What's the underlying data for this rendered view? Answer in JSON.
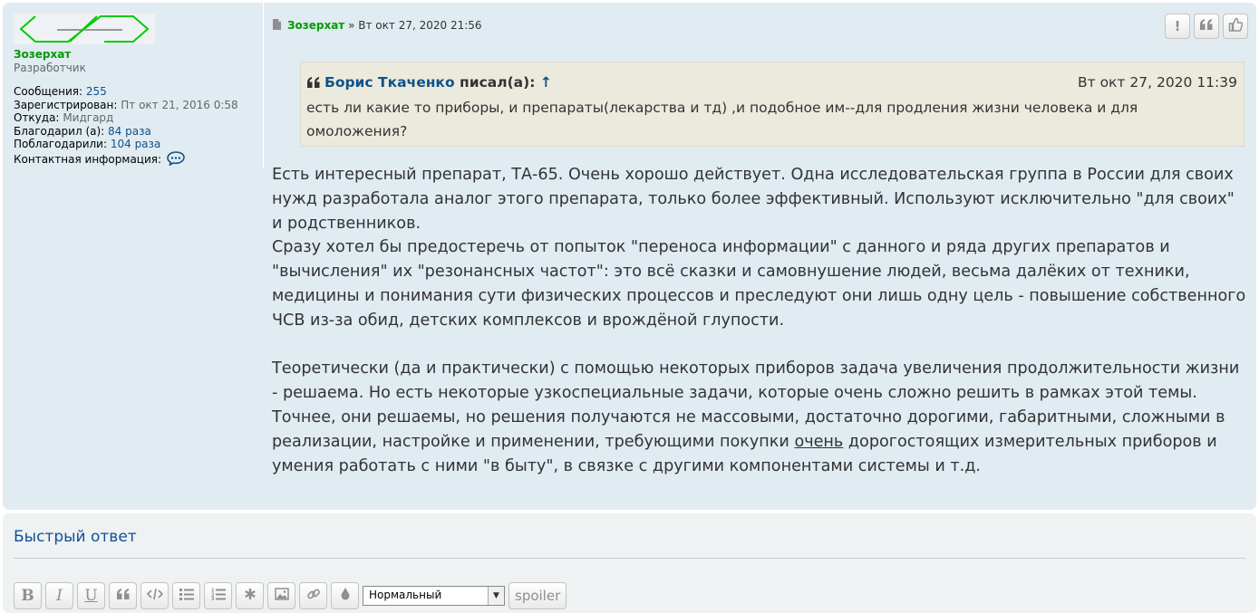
{
  "user": {
    "name": "Зозерхат",
    "rank": "Разработчик",
    "stats": [
      {
        "label": "Сообщения:",
        "value": "255"
      },
      {
        "label": "Зарегистрирован:",
        "value": "Пт окт 21, 2016 0:58"
      },
      {
        "label": "Откуда:",
        "value": "Мидгард"
      },
      {
        "label": "Благодарил (а):",
        "value": "84 раза"
      },
      {
        "label": "Поблагодарили:",
        "value": "104 раза"
      }
    ],
    "contact_label": "Контактная информация:"
  },
  "post": {
    "author": "Зозерхат",
    "separator": "»",
    "datetime": "Вт окт 27, 2020 21:56",
    "buttons": {
      "report": "!",
      "quote": "❝",
      "thanks": "👍"
    },
    "quote": {
      "author": "Борис Ткаченко",
      "wrote": "писал(а):",
      "arrow": "↑",
      "date": "Вт окт 27, 2020 11:39",
      "text": "есть ли какие то приборы, и препараты(лекарства и тд) ,и подобное им--для продления жизни человека и для омоложения?"
    },
    "paragraph1": "Есть интересный препарат, ТА-65. Очень хорошо действует. Одна исследовательская группа в России для своих нужд разработала аналог этого препарата, только более эффективный. Используют исключительно \"для своих\" и родственников.",
    "paragraph2": "Сразу хотел бы предостеречь от попыток \"переноса информации\" с данного и ряда других препаратов и \"вычисления\" их \"резонансных частот\": это всё сказки и самовнушение людей, весьма далёких от техники, медицины и понимания сути физических процессов и преследуют они лишь одну цель - повышение собственного ЧСВ из-за обид, детских комплексов и врождёной глупости.",
    "paragraph3_a": "Теоретически (да и практически) с помощью некоторых приборов задача увеличения продолжительности жизни - решаема. Но есть некоторые узкоспециальные задачи, которые очень сложно решить в рамках этой темы. Точнее, они решаемы, но решения получаются не массовыми, достаточно дорогими, габаритными, сложными в реализации, настройке и применении, требующими покупки ",
    "paragraph3_u": "очень",
    "paragraph3_b": " дорогостоящих измерительных приборов и умения работать с ними \"в быту\", в связке с другими компонентами системы и т.д."
  },
  "quick_reply": {
    "title": "Быстрый ответ",
    "toolbar": {
      "bold": "B",
      "italic": "I",
      "underline": "U",
      "font_size_selected": "Нормальный",
      "spoiler": "spoiler"
    }
  },
  "colors": {
    "username": "#009900",
    "link": "#105289",
    "post_bg": "#e1ebf2",
    "quote_bg": "#ebeadd"
  }
}
